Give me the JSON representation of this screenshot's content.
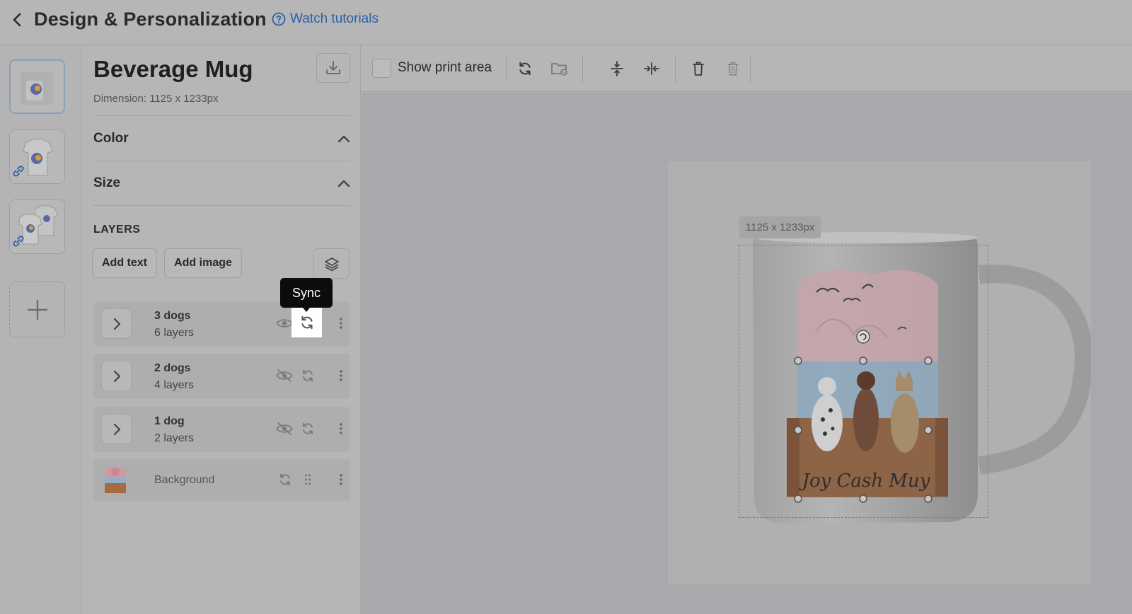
{
  "header": {
    "title": "Design & Personalization",
    "watch_tutorials": "Watch tutorials"
  },
  "product": {
    "name": "Beverage Mug",
    "dimension": "Dimension: 1125 x 1233px"
  },
  "sections": {
    "color": "Color",
    "size": "Size"
  },
  "layers": {
    "label": "LAYERS",
    "add_text": "Add text",
    "add_image": "Add image",
    "items": [
      {
        "name": "3 dogs",
        "sub": "6 layers",
        "visible": true
      },
      {
        "name": "2 dogs",
        "sub": "4 layers",
        "visible": false
      },
      {
        "name": "1 dog",
        "sub": "2 layers",
        "visible": false
      },
      {
        "name": "Background"
      }
    ]
  },
  "tooltip": {
    "sync": "Sync"
  },
  "toolbar": {
    "show_print_area": "Show print area"
  },
  "canvas": {
    "size_label": "1125 x 1233px",
    "mug_text": "Joy Cash Muy"
  },
  "colors": {
    "accent_link": "#2b5fa8",
    "tooltip_bg": "#0c0c0c"
  }
}
